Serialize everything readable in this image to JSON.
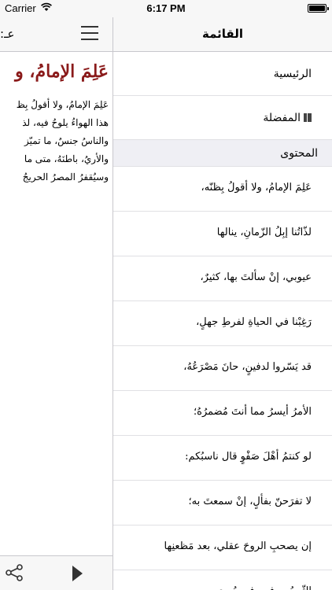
{
  "status_bar": {
    "carrier": "Carrier",
    "time": "6:17 PM",
    "battery_level": 1.0
  },
  "reader": {
    "nav_title": ":عـ",
    "heading": "عَلِمَ الإمامُ، و",
    "body_lines": [
      "عَلِمَ الإمامُ، ولا أقولُ بِظ",
      "هذا الهواءُ يلوحُ فيه، لذ",
      "والناسُ جنسٌ، ما تميّز",
      "والأريُ، باطنَهُ، متى ما",
      "وسيُقفرُ المصرُ الحريجُ"
    ],
    "icons": {
      "menu": "hamburger-menu-icon",
      "share": "share-icon",
      "play": "play-icon"
    }
  },
  "sidebar": {
    "title": "القائمة",
    "main_items": [
      {
        "label": "الرئيسية"
      },
      {
        "label": "المفضلة",
        "icon": "book-icon"
      }
    ],
    "section_header": "المحتوى",
    "content_items": [
      {
        "label": "عَلِمَ الإمامُ، ولا أقولُ بِظنّه،"
      },
      {
        "label": "لذّاتُنا إبِلُ الزّمانِ، ينالها"
      },
      {
        "label": "عيوبي، إنْ سألتَ بها، كثيرٌ،"
      },
      {
        "label": "رَغِبْنا في الحياةِ لفرطِ جهلٍ،"
      },
      {
        "label": "قد يَسّروا لدفينٍ، حانَ مَصْرَعُهُ،"
      },
      {
        "label": "الأمرُ أيسرُ مما أنتَ مُضمرُهُ؛"
      },
      {
        "label": "لو كنتمُ أهْلَ صَفْوٍ قال ناسبُكم:"
      },
      {
        "label": "لا تفرَحنّ بفألٍ، إنْ سمعتَ به؛"
      },
      {
        "label": "إن يصحبِ الروحَ عقلي، بعد مَظعنِها"
      },
      {
        "label": "الثّوبُ... فيه، فهو يُهوى..."
      }
    ]
  }
}
